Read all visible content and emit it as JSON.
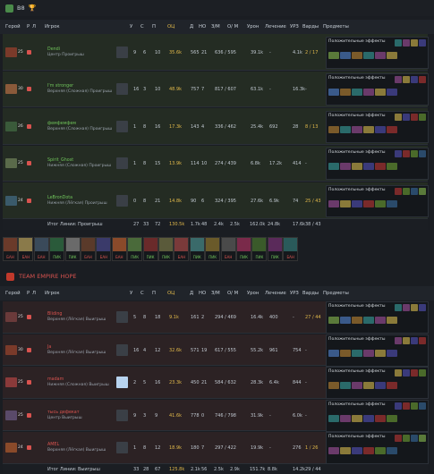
{
  "top_team": {
    "name": "B8"
  },
  "bottom_team": {
    "name": "TEAM EMPIRE HOPE"
  },
  "columns": {
    "hero": "Герой",
    "role": "Р",
    "lane": "Л",
    "player": "Игрок",
    "k": "У",
    "d": "С",
    "a": "П",
    "ranked": "ОЦ",
    "networth": "Д",
    "nw_short": "НО",
    "gpm": "З/М",
    "xpm": "О/ М",
    "damage": "Урон",
    "heal": "Лечение",
    "bldg": "УРЗ",
    "wards": "Варды",
    "items": "Предметы"
  },
  "effects_label": "Положительные эффекты",
  "top_players": [
    {
      "level": "25",
      "name": "Dendi",
      "result": "Центр Проигрыш",
      "k": "9",
      "d": "6",
      "a": "10",
      "rating": "35.6k",
      "nw": "565",
      "nw2": "21",
      "gpm_xpm": "636 / 595",
      "damage": "39.1k",
      "heal": "-",
      "bldg": "4.1k",
      "wards": "2 / 17"
    },
    {
      "level": "30",
      "name": "I'm stronger",
      "result": "Верхняя (Сложная) Проигрыш",
      "k": "16",
      "d": "3",
      "a": "10",
      "rating": "48.9k",
      "nw": "757",
      "nw2": "7",
      "gpm_xpm": "817 / 607",
      "damage": "63.1k",
      "heal": "-",
      "bldg": "16.3k",
      "wards": "-"
    },
    {
      "level": "26",
      "name": "фемфемфем",
      "result": "Верхняя (Сложная) Проигрыш",
      "k": "1",
      "d": "8",
      "a": "16",
      "rating": "17.3k",
      "nw": "143",
      "nw2": "4",
      "gpm_xpm": "336 / 462",
      "damage": "25.4k",
      "heal": "692",
      "bldg": "28",
      "wards": "8 / 13"
    },
    {
      "level": "25",
      "name": "Spirit_Ghost",
      "result": "Нижняя (Сложная) Проигрыш",
      "k": "1",
      "d": "8",
      "a": "15",
      "rating": "13.9k",
      "nw": "114",
      "nw2": "10",
      "gpm_xpm": "274 / 439",
      "damage": "6.8k",
      "heal": "17.2k",
      "bldg": "414",
      "wards": "-"
    },
    {
      "level": "24",
      "name": "LeBronDota",
      "result": "Нижняя (Лёгкая) Проигрыш",
      "k": "0",
      "d": "8",
      "a": "21",
      "rating": "14.8k",
      "nw": "90",
      "nw2": "6",
      "gpm_xpm": "324 / 395",
      "damage": "27.6k",
      "heal": "6.9k",
      "bldg": "74",
      "wards": "25 / 43"
    }
  ],
  "top_footer": {
    "label": "Итог Линии: Проигрыш",
    "k": "27",
    "d": "33",
    "a": "72",
    "rating": "130.5k",
    "nw": "1.7k",
    "nw2": "48",
    "gpm": "2.4k",
    "xpm": "2.5k",
    "damage": "162.0k",
    "heal": "24.8k",
    "bldg": "17.6k",
    "wards": "38 / 43"
  },
  "draft": [
    "БАН",
    "БАН",
    "БАН",
    "ПИК",
    "ПИК",
    "БАН",
    "БАН",
    "БАН",
    "ПИК",
    "ПИК",
    "ПИК",
    "БАН",
    "ПИК",
    "ПИК",
    "БАН",
    "ПИК",
    "ПИК",
    "ПИК",
    "БАН"
  ],
  "bottom_players": [
    {
      "level": "25",
      "name": "Bliding",
      "result": "Верхняя (Лёгкая) Выигрыш",
      "k": "5",
      "d": "8",
      "a": "18",
      "rating": "9.1k",
      "nw": "161",
      "nw2": "2",
      "gpm_xpm": "294 / 469",
      "damage": "16.4k",
      "heal": "400",
      "bldg": "-",
      "wards": "27 / 44"
    },
    {
      "level": "30",
      "name": "Ja",
      "result": "Верхняя (Лёгкая) Выигрыш",
      "k": "16",
      "d": "4",
      "a": "12",
      "rating": "32.6k",
      "nw": "571",
      "nw2": "19",
      "gpm_xpm": "617 / 555",
      "damage": "55.2k",
      "heal": "961",
      "bldg": "754",
      "wards": "-"
    },
    {
      "level": "25",
      "name": "madam",
      "result": "Нижняя (Сложная) Выигрыш",
      "k": "2",
      "d": "5",
      "a": "16",
      "rating": "23.3k",
      "nw": "450",
      "nw2": "21",
      "gpm_xpm": "584 / 632",
      "damage": "28.3k",
      "heal": "6.4k",
      "bldg": "844",
      "wards": "-"
    },
    {
      "level": "25",
      "name": "тысь дефекат",
      "result": "Центр Выигрыш",
      "k": "9",
      "d": "3",
      "a": "9",
      "rating": "41.6k",
      "nw": "778",
      "nw2": "0",
      "gpm_xpm": "746 / 798",
      "damage": "31.9k",
      "heal": "-",
      "bldg": "6.0k",
      "wards": "-"
    },
    {
      "level": "24",
      "name": "AMEL",
      "result": "Верхняя (Лёгкая) Выигрыш",
      "k": "1",
      "d": "8",
      "a": "12",
      "rating": "18.9k",
      "nw": "180",
      "nw2": "7",
      "gpm_xpm": "297 / 422",
      "damage": "19.9k",
      "heal": "-",
      "bldg": "276",
      "wards": "1 / 26"
    }
  ],
  "bottom_footer": {
    "label": "Итог Линии: Выигрыш",
    "k": "33",
    "d": "28",
    "a": "67",
    "rating": "125.8k",
    "nw": "2.1k",
    "nw2": "56",
    "gpm": "2.5k",
    "xpm": "2.9k",
    "damage": "151.7k",
    "heal": "8.8k",
    "bldg": "14.2k",
    "wards": "29 / 44"
  }
}
